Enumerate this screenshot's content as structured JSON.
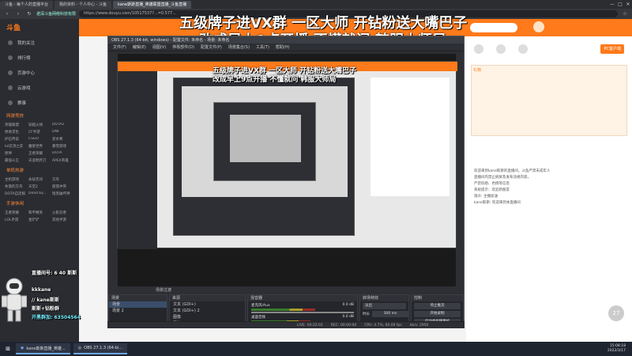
{
  "browser": {
    "tabs": [
      "斗鱼 - 每个人的直播平台",
      "我的资料 - 个人中心 - 斗鱼",
      "kane斯斯直播_英雄联盟直播_斗鱼直播"
    ],
    "site_label": "诺深斗鱼网络科技有限",
    "url": "https://www.douyu.com/10517537?...=0.577..."
  },
  "sidebar": {
    "logo": "斗鱼",
    "items": [
      "我的关注",
      "排行榜",
      "页游中心",
      "云游戏",
      "赛事"
    ],
    "section_hot": "网游竞技",
    "hot_games": [
      "英雄联盟",
      "穿越火线",
      "DOTA2",
      "绝地求生",
      "CF手游",
      "DNF",
      "炉石传说",
      "CSGO",
      "逆水寒",
      "lol云顶之弈",
      "魔兽世界",
      "暴雪游戏",
      "原神",
      "王者荣耀",
      "DOTA",
      "最强斗王",
      "天涯明月刀",
      "APEX英雄"
    ],
    "section_mobile": "单机热游",
    "mobile_games": [
      "主机游戏",
      "永劫无间",
      "方舟",
      "失落的方舟",
      "天堂2",
      "部落冲突",
      "DOTA自走棋",
      "Dead by...",
      "暗黑破坏神"
    ],
    "section_hand": "手游休闲",
    "hand_games": [
      "王者荣耀",
      "和平精英",
      "火影忍者",
      "LOL手游",
      "金铲铲",
      "其他手游"
    ]
  },
  "overlay": {
    "headline_1": "五级牌子进VX群 一区大师 开钻粉送大嘴巴子",
    "headline_2": "改成早上9点开播  不懂就问  韩服大师局",
    "streamer_lines": [
      "直播间号: 6 40 斯斯",
      "kkkane",
      "// kane斯斯",
      "斯斯+钻粉群",
      "开黑群加: 63504564"
    ]
  },
  "obs": {
    "title": "OBS 27.1.3 (64-bit, windows) - 配置文件: 未命名 - 场景: 未命名",
    "menu": [
      "文件(F)",
      "编辑(E)",
      "视图(V)",
      "停靠部件(D)",
      "配置文件(P)",
      "场景集合(S)",
      "工具(T)",
      "帮助(H)"
    ],
    "scene_header": "场景",
    "scenes": [
      "场景",
      "场景 2"
    ],
    "sources_header": "来源",
    "sources": [
      "文本 (GDI+)",
      "文本 (GDI+) 2",
      "图像",
      "图像 2",
      "图像 3",
      "显示器采集"
    ],
    "mixer_header": "混音器",
    "mixer": [
      {
        "name": "麦克风/Aux",
        "db": "0.0 dB",
        "level": 0.62
      },
      {
        "name": "桌面音频",
        "db": "0.0 dB",
        "level": 0.58
      }
    ],
    "transitions_header": "转场特效",
    "transition": "淡出",
    "duration_label": "时长",
    "duration": "300 ms",
    "controls_header": "控制",
    "controls": [
      "停止推流",
      "开始录制",
      "启动虚拟摄像机",
      "工作室模式",
      "设置",
      "退出"
    ],
    "status": {
      "live": "LIVE: 00:22:01",
      "rec": "REC: 00:00:00",
      "cpu": "CPU: 4.7%, 60.00 fps",
      "kbps": "kb/s: 2950"
    },
    "bottom_tab": "场景过渡"
  },
  "douyu_right": {
    "pc_client": "PC客户端",
    "gift_label": "礼物",
    "chat": [
      "欢迎来到kane斯斯的直播间，斗鱼严禁未成年人",
      "直播间内禁止刷屏及发布违规内容，",
      "严禁低俗、色情等信息",
      "系统提示：欢迎新朋友",
      "观众: 主播加油",
      "kane斯斯: 欢迎来到本直播间"
    ],
    "viewers": "27"
  },
  "taskbar": {
    "items": [
      "kane斯斯直播_英雄...",
      "OBS 27.1.3 (64-bi..."
    ],
    "time": "15:08:18",
    "date": "2022/3/17"
  },
  "colors": {
    "accent": "#ff7a1a",
    "obs_bg": "#2d2f34",
    "taskbar": "#1e2430"
  }
}
